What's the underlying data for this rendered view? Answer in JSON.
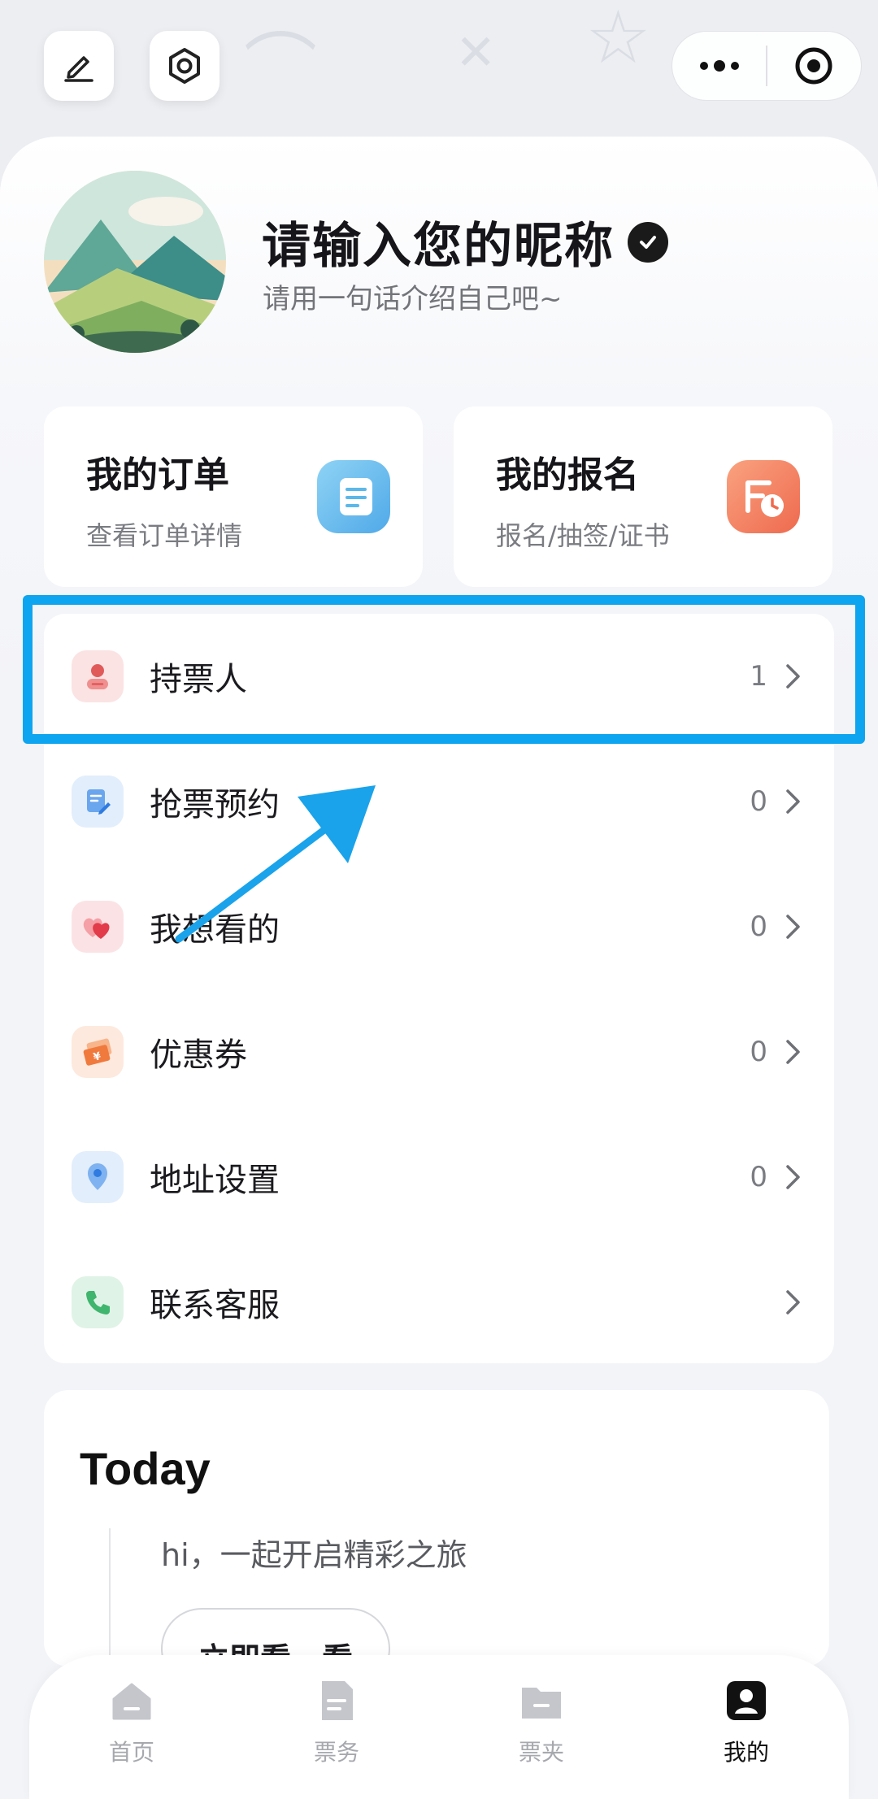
{
  "profile": {
    "nickname": "请输入您的昵称",
    "bio": "请用一句话介绍自己吧~"
  },
  "cards": [
    {
      "title": "我的订单",
      "subtitle": "查看订单详情",
      "icon": "order-list-icon",
      "color": "#5bb8ea"
    },
    {
      "title": "我的报名",
      "subtitle": "报名/抽签/证书",
      "icon": "registration-calendar-icon",
      "color": "#f4775a"
    }
  ],
  "menu": [
    {
      "label": "持票人",
      "count": "1",
      "icon": "ticket-holder-icon"
    },
    {
      "label": "抢票预约",
      "count": "0",
      "icon": "booking-edit-icon"
    },
    {
      "label": "我想看的",
      "count": "0",
      "icon": "heart-icon"
    },
    {
      "label": "优惠券",
      "count": "0",
      "icon": "coupon-icon"
    },
    {
      "label": "地址设置",
      "count": "0",
      "icon": "location-pin-icon"
    },
    {
      "label": "联系客服",
      "count": "",
      "icon": "phone-icon"
    }
  ],
  "today": {
    "title": "Today",
    "text": "hi，一起开启精彩之旅",
    "button": "立即看一看"
  },
  "tabs": [
    {
      "label": "首页",
      "icon": "home-icon",
      "active": false
    },
    {
      "label": "票务",
      "icon": "ticket-doc-icon",
      "active": false
    },
    {
      "label": "票夹",
      "icon": "ticket-folder-icon",
      "active": false
    },
    {
      "label": "我的",
      "icon": "profile-icon",
      "active": true
    }
  ],
  "colors": {
    "highlight": "#0ea5f0",
    "arrow": "#1aa3ea"
  }
}
